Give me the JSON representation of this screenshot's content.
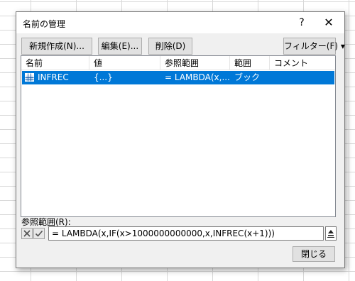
{
  "dialog": {
    "title": "名前の管理",
    "help_label": "?",
    "close_glyph": "✕"
  },
  "toolbar": {
    "new_label": "新規作成(N)...",
    "edit_label": "編集(E)...",
    "delete_label": "削除(D)",
    "filter_label": "フィルター(F) ▾"
  },
  "list": {
    "columns": [
      "名前",
      "値",
      "参照範囲",
      "範囲",
      "コメント"
    ],
    "rows": [
      {
        "name": "INFREC",
        "value": "{...}",
        "refers_to": "= LAMBDA(x,...",
        "scope": "ブック",
        "comment": "",
        "selected": true
      }
    ]
  },
  "reference": {
    "label": "参照範囲(R):",
    "formula": "= LAMBDA(x,IF(x>1000000000000,x,INFREC(x+1)))",
    "cancel_icon": "cross-icon",
    "confirm_icon": "check-icon",
    "collapse_icon": "collapse-up-icon"
  },
  "footer": {
    "close_label": "閉じる"
  },
  "colors": {
    "selection": "#0078d7",
    "dialog_bg": "#f0f0f0"
  }
}
